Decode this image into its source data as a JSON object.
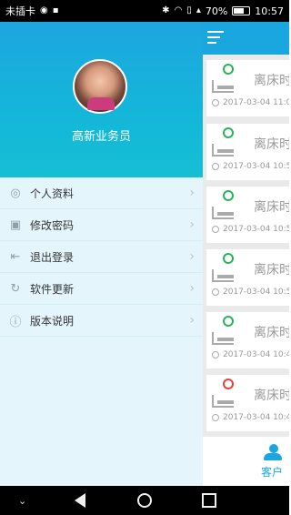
{
  "status_bar": {
    "carrier": "未插卡",
    "battery_percent": "70%",
    "battery_level": 0.7,
    "time": "10:57"
  },
  "drawer": {
    "user_name": "高新业务员",
    "menu": [
      {
        "label": "个人资料",
        "icon": "person-icon"
      },
      {
        "label": "修改密码",
        "icon": "lock-icon"
      },
      {
        "label": "退出登录",
        "icon": "logout-icon"
      },
      {
        "label": "软件更新",
        "icon": "refresh-icon"
      },
      {
        "label": "版本说明",
        "icon": "info-icon"
      }
    ]
  },
  "main": {
    "cards": [
      {
        "title": "离床时",
        "time": "2017-03-04 11:0",
        "status_color": "#27b35a"
      },
      {
        "title": "离床时",
        "time": "2017-03-04 10:5",
        "status_color": "#27b35a"
      },
      {
        "title": "离床时",
        "time": "2017-03-04 10:5",
        "status_color": "#27b35a"
      },
      {
        "title": "离床时",
        "time": "2017-03-04 10:5",
        "status_color": "#27b35a"
      },
      {
        "title": "离床时",
        "time": "2017-03-04 10:4",
        "status_color": "#27b35a"
      },
      {
        "title": "离床时",
        "time": "2017-03-04 10:4",
        "status_color": "#e2413a"
      }
    ],
    "bottom_tab_label": "客户"
  },
  "colors": {
    "primary": "#1aa7e0",
    "drawer_bg": "#e4f6fc",
    "green": "#27b35a",
    "red": "#e2413a"
  }
}
